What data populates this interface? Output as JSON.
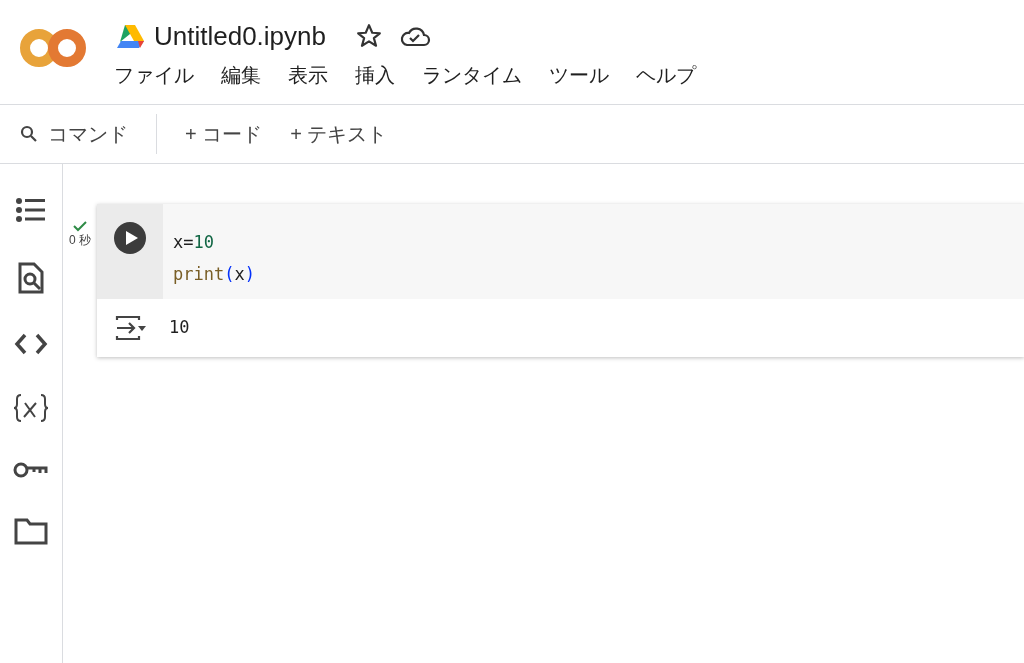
{
  "notebook": {
    "title": "Untitled0.ipynb"
  },
  "menu": [
    "ファイル",
    "編集",
    "表示",
    "挿入",
    "ランタイム",
    "ツール",
    "ヘルプ"
  ],
  "toolbar": {
    "command": "コマンド",
    "add_code": "+ コード",
    "add_text": "+ テキスト"
  },
  "cell": {
    "status": "0 秒",
    "code_lines": [
      [
        {
          "kind": "plain",
          "text": "x="
        },
        {
          "kind": "number",
          "text": "10"
        }
      ],
      [
        {
          "kind": "builtin",
          "text": "print"
        },
        {
          "kind": "paren",
          "text": "("
        },
        {
          "kind": "plain",
          "text": "x"
        },
        {
          "kind": "paren",
          "text": ")"
        }
      ]
    ],
    "output": "10"
  }
}
